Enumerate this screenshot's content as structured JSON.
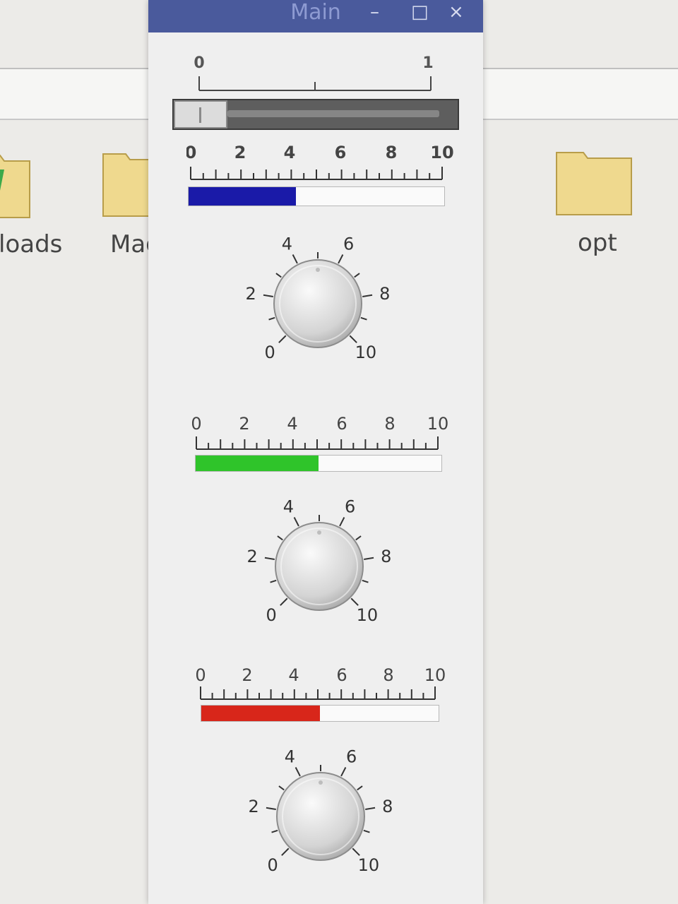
{
  "background": {
    "folders": [
      {
        "label": "loads"
      },
      {
        "label": "Mag"
      },
      {
        "label": "opt"
      }
    ]
  },
  "window": {
    "title": "Main",
    "buttons": {
      "minimize": "–",
      "maximize": "□",
      "close": "×"
    }
  },
  "slider": {
    "scale_labels": [
      "0",
      "1"
    ],
    "value": 0.0,
    "range": [
      0,
      1
    ]
  },
  "meters": [
    {
      "id": "blue",
      "scale_labels": [
        "0",
        "2",
        "4",
        "6",
        "8",
        "10"
      ],
      "value": 4.2,
      "max": 10,
      "color": "#1a1aa8"
    },
    {
      "id": "green",
      "scale_labels": [
        "0",
        "2",
        "4",
        "6",
        "8",
        "10"
      ],
      "value": 5.0,
      "max": 10,
      "color": "#2fc42a"
    },
    {
      "id": "red",
      "scale_labels": [
        "0",
        "2",
        "4",
        "6",
        "8",
        "10"
      ],
      "value": 5.0,
      "max": 10,
      "color": "#d8261a"
    }
  ],
  "knobs": [
    {
      "labels": [
        "0",
        "2",
        "4",
        "6",
        "8",
        "10"
      ],
      "value": 5
    },
    {
      "labels": [
        "0",
        "2",
        "4",
        "6",
        "8",
        "10"
      ],
      "value": 5
    },
    {
      "labels": [
        "0",
        "2",
        "4",
        "6",
        "8",
        "10"
      ],
      "value": 5
    }
  ]
}
